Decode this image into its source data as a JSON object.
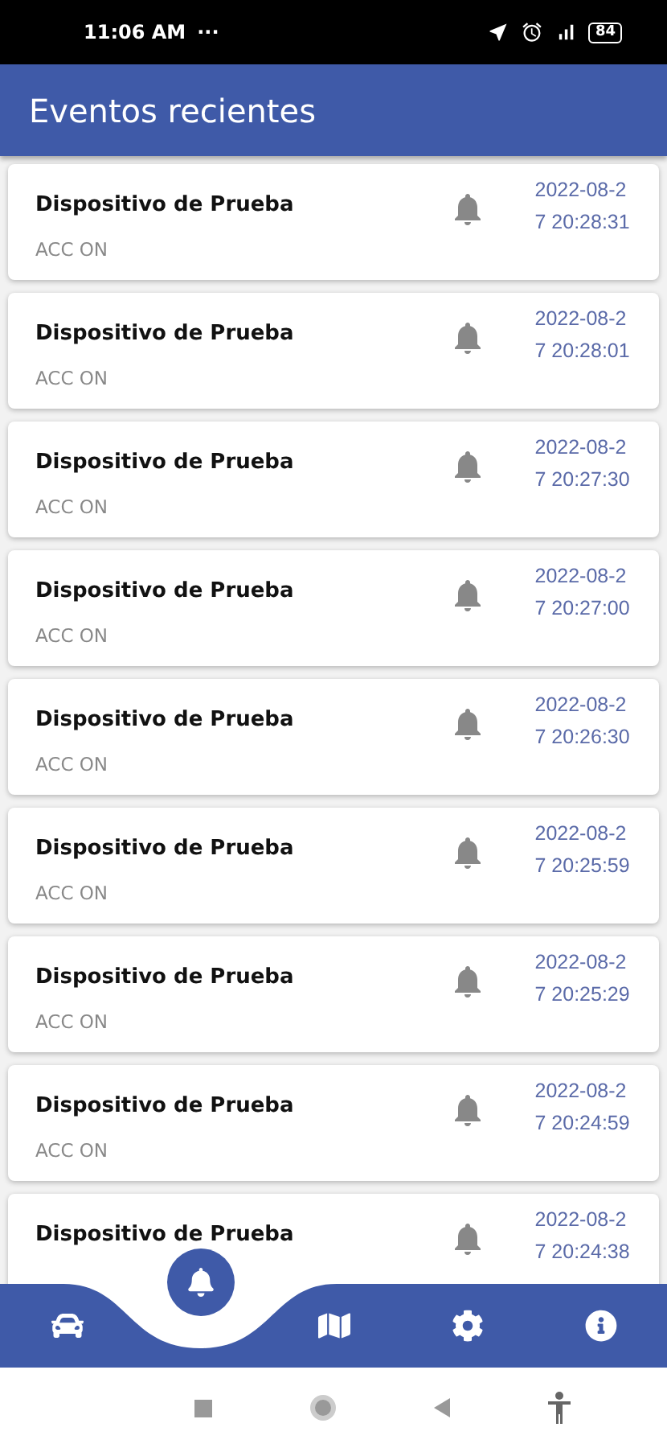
{
  "status_bar": {
    "time": "11:06 AM",
    "more": "···",
    "battery": "84"
  },
  "header": {
    "title": "Eventos recientes"
  },
  "events": [
    {
      "device": "Dispositivo de Prueba",
      "event": "ACC ON",
      "time": "2022-08-27 20:28:31"
    },
    {
      "device": "Dispositivo de Prueba",
      "event": "ACC ON",
      "time": "2022-08-27 20:28:01"
    },
    {
      "device": "Dispositivo de Prueba",
      "event": "ACC ON",
      "time": "2022-08-27 20:27:30"
    },
    {
      "device": "Dispositivo de Prueba",
      "event": "ACC ON",
      "time": "2022-08-27 20:27:00"
    },
    {
      "device": "Dispositivo de Prueba",
      "event": "ACC ON",
      "time": "2022-08-27 20:26:30"
    },
    {
      "device": "Dispositivo de Prueba",
      "event": "ACC ON",
      "time": "2022-08-27 20:25:59"
    },
    {
      "device": "Dispositivo de Prueba",
      "event": "ACC ON",
      "time": "2022-08-27 20:25:29"
    },
    {
      "device": "Dispositivo de Prueba",
      "event": "ACC ON",
      "time": "2022-08-27 20:24:59"
    },
    {
      "device": "Dispositivo de Prueba",
      "time": "2022-08-27 20:24:38"
    }
  ],
  "bottom_nav": [
    {
      "kind": "car",
      "selected": false
    },
    {
      "kind": "bell",
      "selected": true
    },
    {
      "kind": "map",
      "selected": false
    },
    {
      "kind": "settings",
      "selected": false
    },
    {
      "kind": "info",
      "selected": false
    }
  ]
}
